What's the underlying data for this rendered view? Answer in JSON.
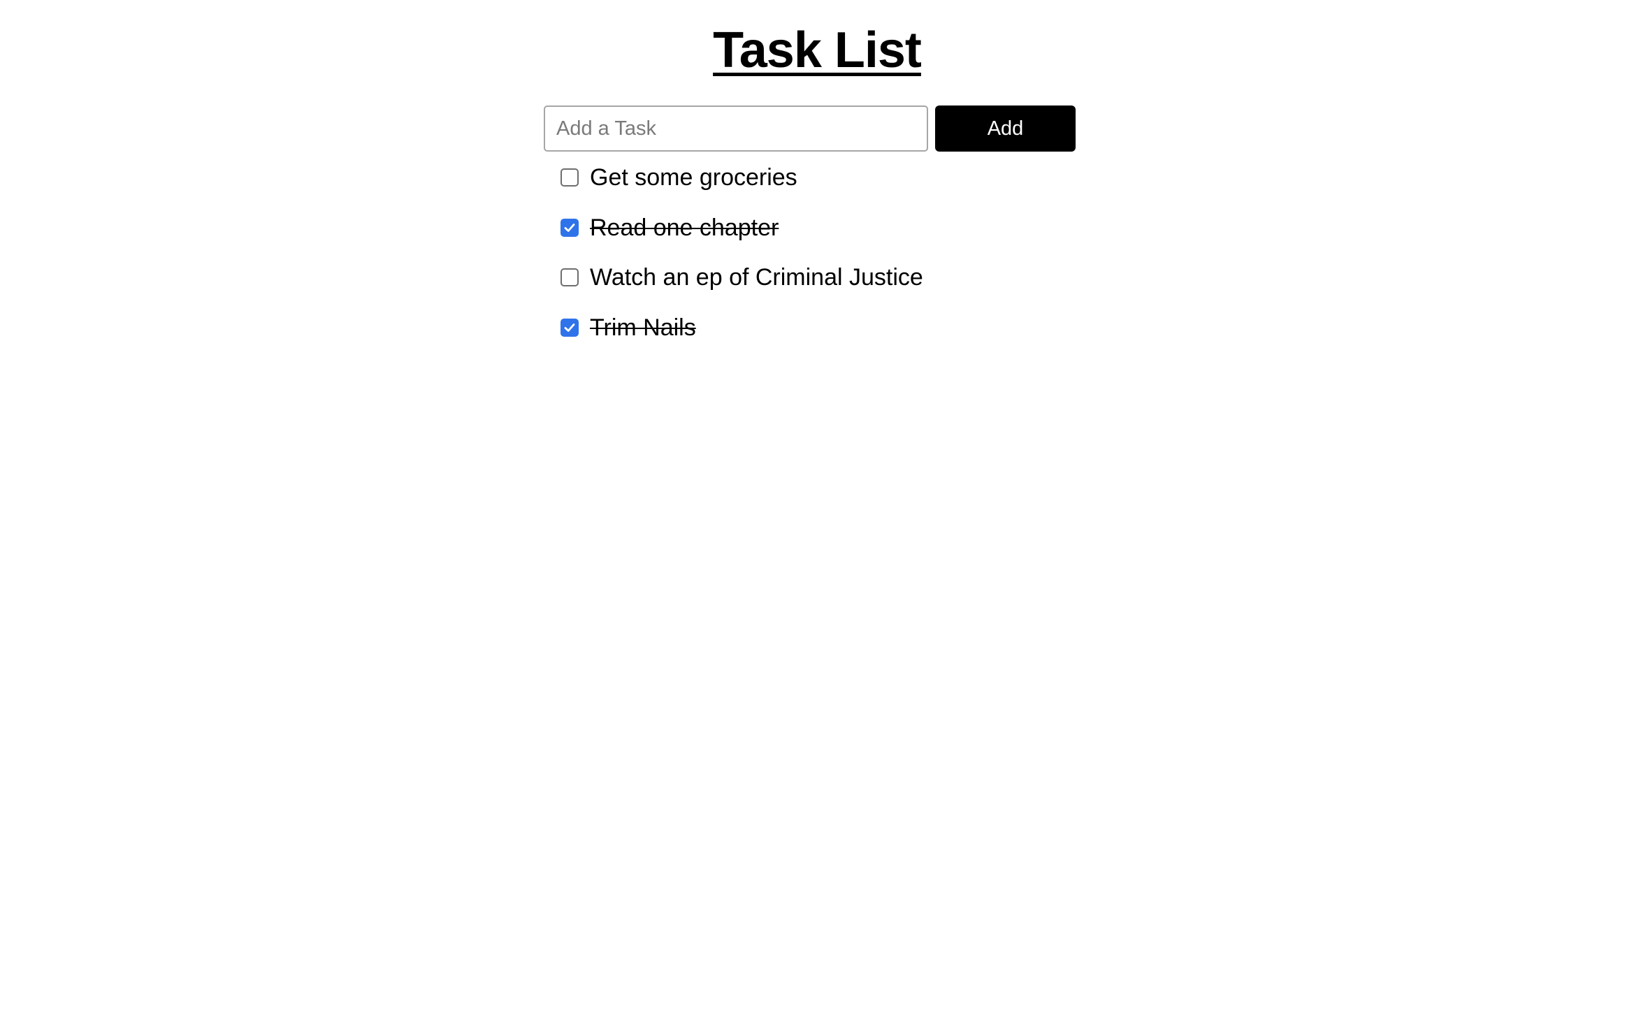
{
  "page": {
    "title": "Task List"
  },
  "form": {
    "input_placeholder": "Add a Task",
    "input_value": "",
    "add_label": "Add"
  },
  "tasks": [
    {
      "label": "Get some groceries",
      "completed": false
    },
    {
      "label": "Read one chapter",
      "completed": true
    },
    {
      "label": "Watch an ep of Criminal Justice",
      "completed": false
    },
    {
      "label": "Trim Nails",
      "completed": true
    }
  ],
  "colors": {
    "checkbox_checked": "#2f73ea",
    "button_bg": "#000000",
    "button_text": "#ffffff"
  },
  "icons": {
    "checkmark": "checkmark-icon"
  }
}
